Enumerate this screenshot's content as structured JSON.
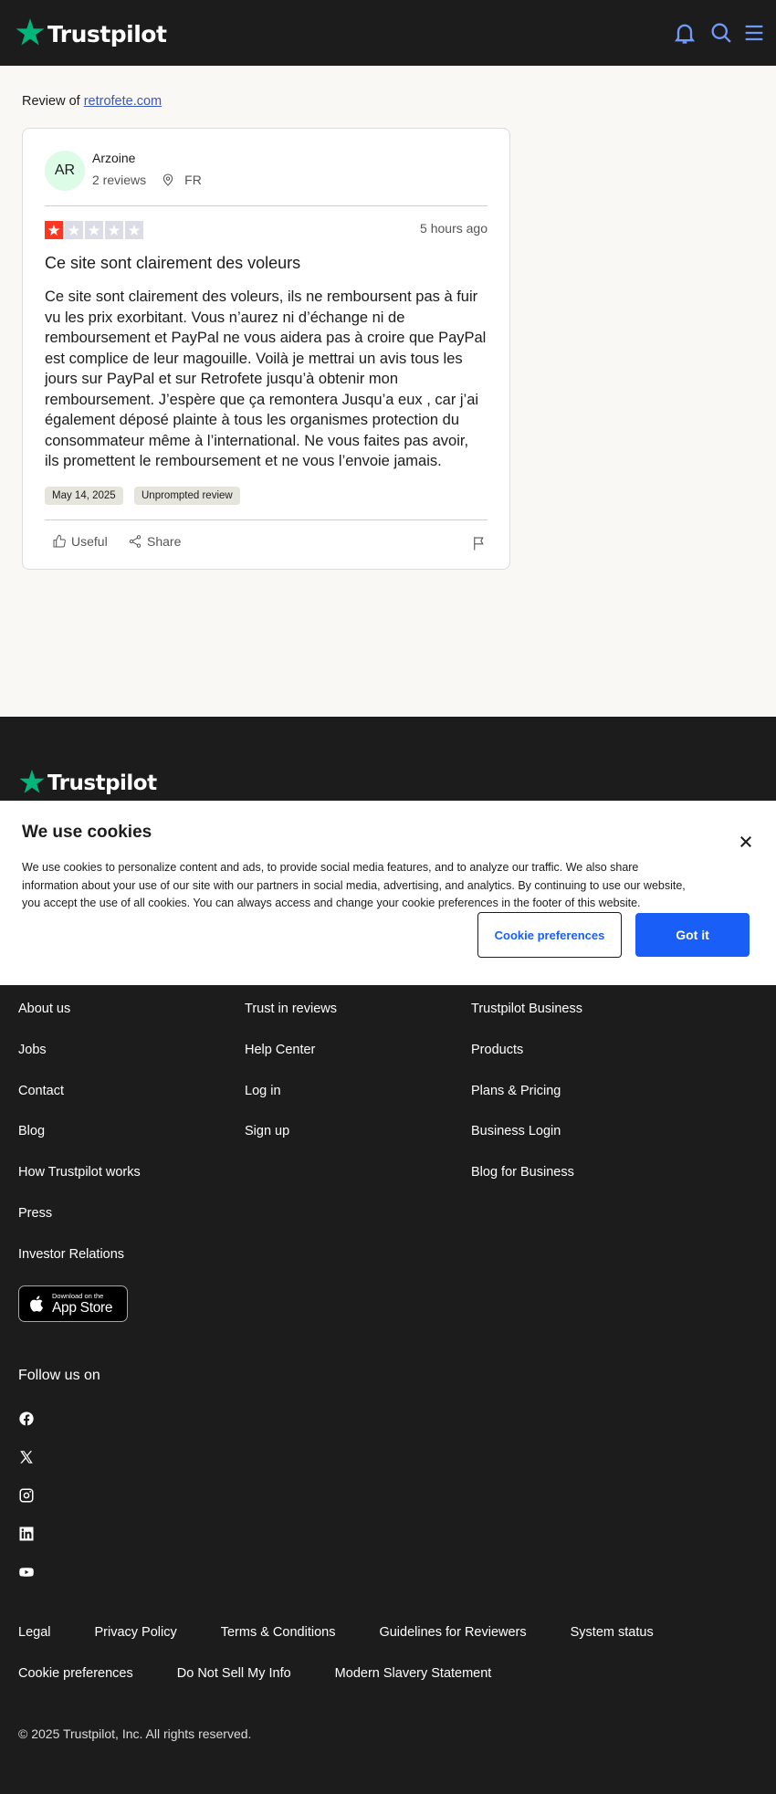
{
  "header": {
    "brand": "Trustpilot",
    "icons": [
      "bell-icon",
      "search-icon",
      "menu-icon"
    ]
  },
  "review": {
    "review_of_label": "Review of",
    "company": "retrofete.com",
    "reviewer": {
      "initials": "AR",
      "name": "Arzoine",
      "reviews_count": "2 reviews",
      "country": "FR"
    },
    "rating": 1,
    "rating_max": 5,
    "colors": {
      "star_active": "#ff3722",
      "star_inactive": "#dcdce6"
    },
    "time_ago": "5 hours ago",
    "title": "Ce site sont clairement des voleurs",
    "body_lines": [
      "Ce site sont clairement des voleurs, ils ne remboursent pas à fuir",
      "vu les prix exorbitant. Vous n’aurez ni d’échange ni de",
      "remboursement et PayPal ne vous aidera pas à croire que PayPal",
      "est complice de leur magouille. Voilà je mettrai un avis tous les",
      "jours sur PayPal et sur Retrofete jusqu’à obtenir mon",
      "remboursement. J’espère que ça remontera Jusqu’a eux , car j’ai",
      "également déposé plainte à tous les organismes protection du",
      "consommateur même à l’international. Ne vous faites pas avoir,",
      "ils promettent le remboursement et ne vous l’envoie jamais."
    ],
    "date_tag": "May 14, 2025",
    "type_tag": "Unprompted review",
    "useful_label": "Useful",
    "share_label": "Share"
  },
  "cookie": {
    "title": "We use cookies",
    "text_lines": [
      "We use cookies to personalize content and ads, to provide social media features, and to analyze our traffic. We also share",
      "information about your use of our site with our partners in social media, advertising, and analytics. By continuing to use our website,",
      "you accept the use of all cookies. You can always access and change your cookie preferences in the footer of this website."
    ],
    "preferences_label": "Cookie preferences",
    "accept_label": "Got it"
  },
  "footer": {
    "brand": "Trustpilot",
    "col1": [
      "About us",
      "Jobs",
      "Contact",
      "Blog",
      "How Trustpilot works",
      "Press",
      "Investor Relations"
    ],
    "col2": [
      "Trust in reviews",
      "Help Center",
      "Log in",
      "Sign up"
    ],
    "col3": [
      "Trustpilot Business",
      "Products",
      "Plans & Pricing",
      "Business Login",
      "Blog for Business"
    ],
    "app_store_small": "Download on the",
    "app_store_big": "App Store",
    "follow_label": "Follow us on",
    "social_icons": [
      "facebook-icon",
      "x-icon",
      "instagram-icon",
      "linkedin-icon",
      "youtube-icon"
    ],
    "legal_row1": [
      "Legal",
      "Privacy Policy",
      "Terms & Conditions",
      "Guidelines for Reviewers",
      "System status"
    ],
    "legal_row2": [
      "Cookie preferences",
      "Do Not Sell My Info",
      "Modern Slavery Statement"
    ],
    "copyright": "© 2025 Trustpilot, Inc. All rights reserved."
  }
}
